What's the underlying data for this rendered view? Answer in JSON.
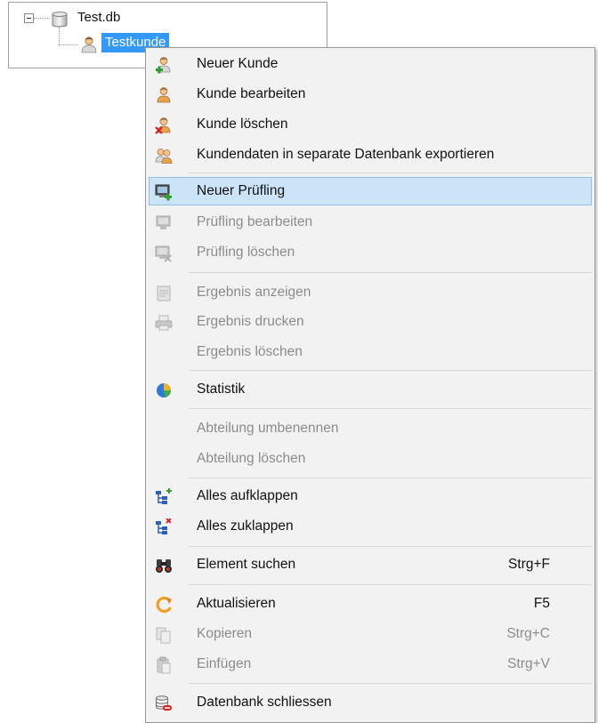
{
  "tree": {
    "root": {
      "label": "Test.db",
      "icon": "database-icon",
      "expanded": true
    },
    "child": {
      "label": "Testkunde",
      "icon": "customer-icon",
      "selected": true
    }
  },
  "menu": {
    "items": [
      {
        "label": "Neuer Kunde",
        "shortcut": "",
        "icon": "add-customer-icon",
        "enabled": true
      },
      {
        "label": "Kunde bearbeiten",
        "shortcut": "",
        "icon": "edit-customer-icon",
        "enabled": true
      },
      {
        "label": "Kunde löschen",
        "shortcut": "",
        "icon": "delete-customer-icon",
        "enabled": true
      },
      {
        "label": "Kundendaten in separate Datenbank exportieren",
        "shortcut": "",
        "icon": "export-customers-icon",
        "enabled": true
      },
      {
        "label": "Neuer Prüfling",
        "shortcut": "",
        "icon": "new-device-icon",
        "enabled": true,
        "highlighted": true
      },
      {
        "label": "Prüfling bearbeiten",
        "shortcut": "",
        "icon": "edit-device-icon",
        "enabled": false
      },
      {
        "label": "Prüfling löschen",
        "shortcut": "",
        "icon": "delete-device-icon",
        "enabled": false
      },
      {
        "label": "Ergebnis anzeigen",
        "shortcut": "",
        "icon": "show-result-icon",
        "enabled": false
      },
      {
        "label": "Ergebnis drucken",
        "shortcut": "",
        "icon": "printer-icon",
        "enabled": false
      },
      {
        "label": "Ergebnis löschen",
        "shortcut": "",
        "icon": "",
        "enabled": false
      },
      {
        "label": "Statistik",
        "shortcut": "",
        "icon": "statistics-pie-icon",
        "enabled": true
      },
      {
        "label": "Abteilung umbenennen",
        "shortcut": "",
        "icon": "",
        "enabled": false
      },
      {
        "label": "Abteilung löschen",
        "shortcut": "",
        "icon": "",
        "enabled": false
      },
      {
        "label": "Alles aufklappen",
        "shortcut": "",
        "icon": "expand-all-icon",
        "enabled": true
      },
      {
        "label": "Alles zuklappen",
        "shortcut": "",
        "icon": "collapse-all-icon",
        "enabled": true
      },
      {
        "label": "Element suchen",
        "shortcut": "Strg+F",
        "icon": "binoculars-icon",
        "enabled": true
      },
      {
        "label": "Aktualisieren",
        "shortcut": "F5",
        "icon": "refresh-icon",
        "enabled": true
      },
      {
        "label": "Kopieren",
        "shortcut": "Strg+C",
        "icon": "copy-icon",
        "enabled": false
      },
      {
        "label": "Einfügen",
        "shortcut": "Strg+V",
        "icon": "paste-icon",
        "enabled": false
      },
      {
        "label": "Datenbank schliessen",
        "shortcut": "",
        "icon": "close-database-icon",
        "enabled": true
      }
    ]
  },
  "colors": {
    "selection": "#3399ff",
    "menu_background": "#f2f2f2",
    "hover_background": "#cce4f7",
    "hover_border": "#8fbfe6",
    "disabled_text": "#8c8c8c"
  }
}
